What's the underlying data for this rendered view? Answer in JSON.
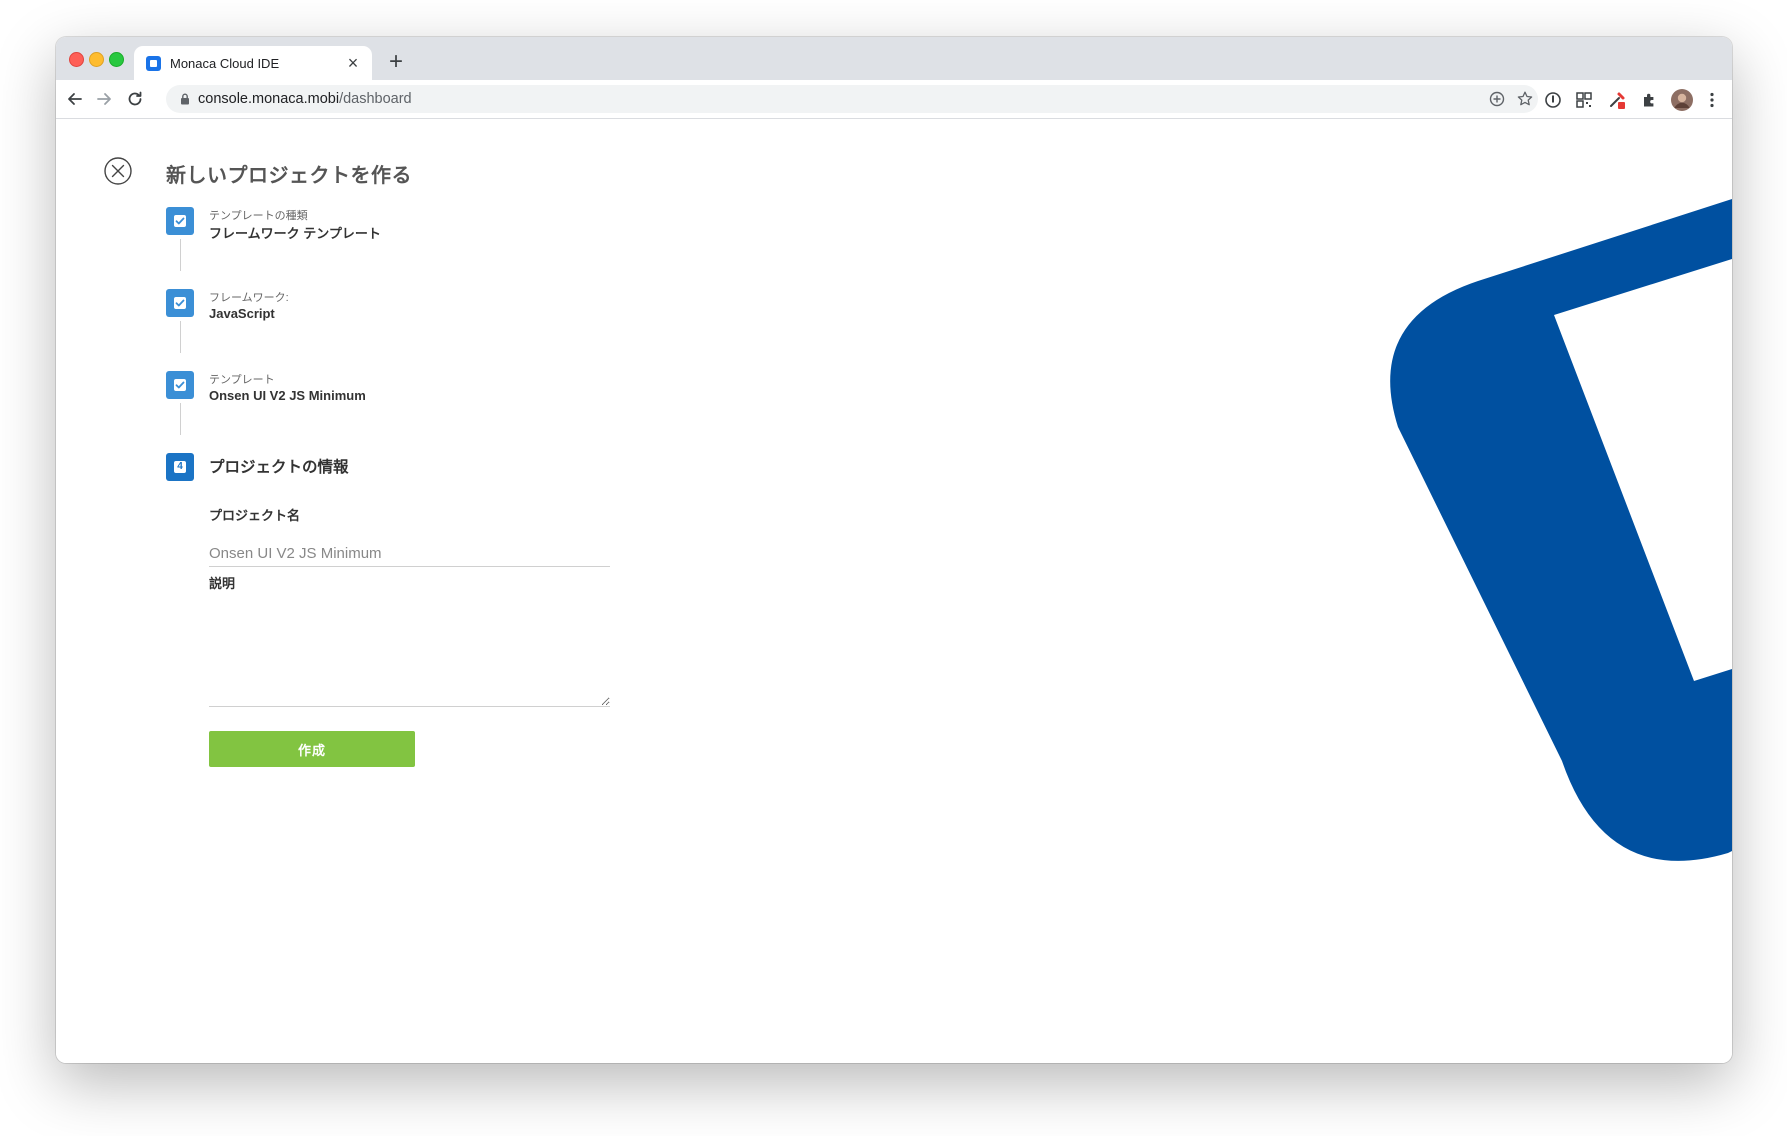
{
  "browser": {
    "tab_title": "Monaca Cloud IDE",
    "tab_close": "×",
    "new_tab": "+",
    "url_host": "console.monaca.mobi",
    "url_path": "/dashboard",
    "icons": [
      "back-icon",
      "forward-icon",
      "reload-icon",
      "lock-icon",
      "add-to-home-icon",
      "bookmark-star-icon",
      "password-icon",
      "qr-code-icon",
      "eyedropper-extension-icon",
      "extensions-puzzle-icon",
      "profile-avatar",
      "kebab-menu-icon"
    ]
  },
  "page": {
    "title": "新しいプロジェクトを作る",
    "steps": [
      {
        "label": "テンプレートの種類",
        "value": "フレームワーク テンプレート",
        "done": true
      },
      {
        "label": "フレームワーク:",
        "value": "JavaScript",
        "done": true
      },
      {
        "label": "テンプレート",
        "value": "Onsen UI V2 JS Minimum",
        "done": true
      }
    ],
    "current_step": {
      "number": "4",
      "heading": "プロジェクトの情報"
    },
    "form": {
      "name_label": "プロジェクト名",
      "name_placeholder": "Onsen UI V2 JS Minimum",
      "description_label": "説明",
      "submit_label": "作成"
    }
  },
  "colors": {
    "step_done": "#3b8fd6",
    "step_active": "#1b74c5",
    "submit_button": "#82c441",
    "brand_logo": "#0050a0"
  }
}
